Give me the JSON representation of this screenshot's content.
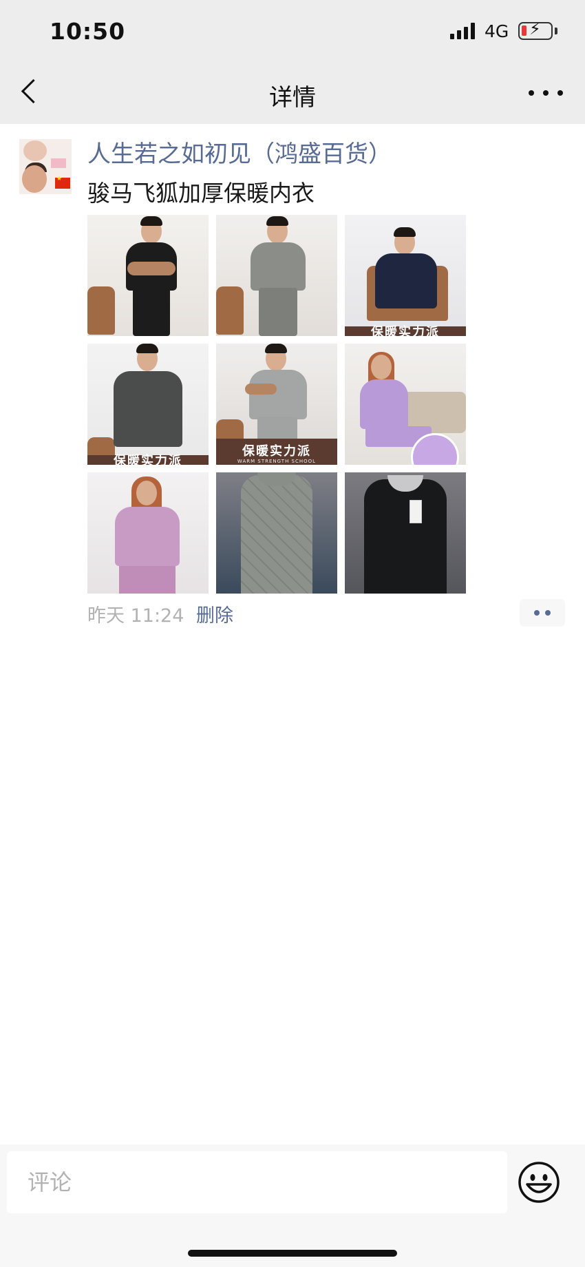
{
  "status_bar": {
    "time": "10:50",
    "network": "4G"
  },
  "nav": {
    "title": "详情"
  },
  "post": {
    "author": "人生若之如初见（鸿盛百货）",
    "text": "骏马飞狐加厚保暖内衣",
    "time": "昨天 11:24",
    "delete_label": "删除",
    "images": [
      {
        "desc": "man-black-thermal",
        "banner": ""
      },
      {
        "desc": "man-grey-thermal",
        "banner": ""
      },
      {
        "desc": "man-navy-thermal",
        "banner": "保暖实力派"
      },
      {
        "desc": "man-dark-grey-thermal",
        "banner": "保暖实力派"
      },
      {
        "desc": "man-light-grey-thermal",
        "banner": "保暖实力派",
        "banner_sub": "WARM STRENGTH SCHOOL"
      },
      {
        "desc": "woman-lavender-thermal",
        "banner": ""
      },
      {
        "desc": "woman-pink-thermal",
        "banner": ""
      },
      {
        "desc": "grey-knit-vest",
        "banner": ""
      },
      {
        "desc": "black-knit-vest",
        "banner": ""
      }
    ]
  },
  "comment": {
    "placeholder": "评论"
  },
  "colors": {
    "link": "#576b95",
    "nav_bg": "#ededed",
    "meta": "#b2b2b2"
  },
  "icons": {
    "back": "chevron-left-icon",
    "more": "more-dots-icon",
    "emoji": "smiley-face-icon"
  }
}
